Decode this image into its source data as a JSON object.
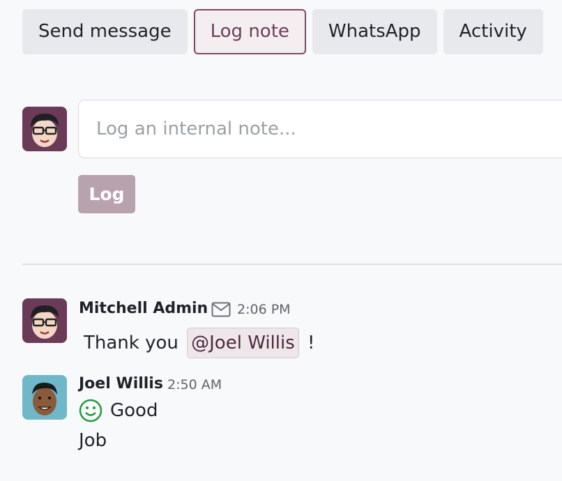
{
  "tabs": [
    {
      "label": "Send message"
    },
    {
      "label": "Log note"
    },
    {
      "label": "WhatsApp"
    },
    {
      "label": "Activity"
    }
  ],
  "composer": {
    "placeholder": "Log an internal note...",
    "submit_label": "Log"
  },
  "messages": [
    {
      "author": "Mitchell Admin",
      "time": "2:06 PM",
      "text_before": "Thank you",
      "mention": "@Joel Willis",
      "text_after": "!",
      "icon": "envelope-icon"
    },
    {
      "author": "Joel Willis",
      "time": "2:50 AM",
      "line1": "Good",
      "line2": "Job",
      "icon": "smiley-icon"
    }
  ],
  "colors": {
    "accent": "#7a4a63",
    "log_button": "#b8a2ae",
    "emoji": "#1e9a3c"
  }
}
